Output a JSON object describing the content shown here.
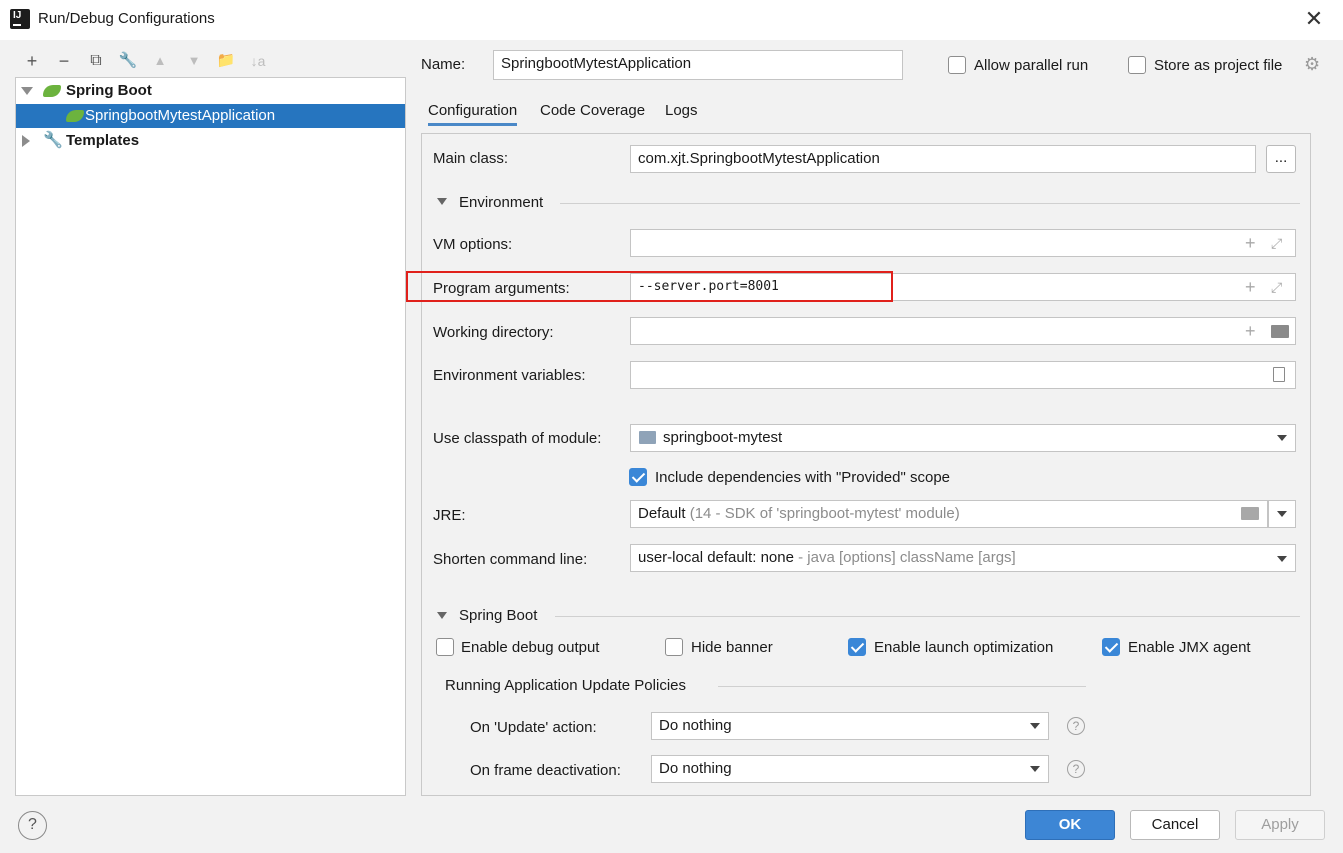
{
  "window": {
    "title": "Run/Debug Configurations"
  },
  "toolbar": {
    "add": "+",
    "remove": "−",
    "copy": "⧉",
    "edit": "🔧",
    "up": "▲",
    "down": "▼",
    "folder": "📁",
    "sort": "↓a"
  },
  "tree": {
    "groups": [
      {
        "label": "Spring Boot",
        "expanded": true,
        "items": [
          {
            "label": "SpringbootMytestApplication",
            "selected": true
          }
        ]
      },
      {
        "label": "Templates",
        "expanded": false,
        "items": []
      }
    ]
  },
  "header": {
    "name_label": "Name:",
    "name_value": "SpringbootMytestApplication",
    "allow_parallel_label": "Allow parallel run",
    "allow_parallel_checked": false,
    "store_project_label": "Store as project file",
    "store_project_checked": false
  },
  "tabs": [
    "Configuration",
    "Code Coverage",
    "Logs"
  ],
  "config": {
    "main_class_label": "Main class:",
    "main_class_value": "com.xjt.SpringbootMytestApplication",
    "browse_label": "...",
    "environment_section": "Environment",
    "vm_options_label": "VM options:",
    "vm_options_value": "",
    "program_args_label": "Program arguments:",
    "program_args_value": "--server.port=8001",
    "working_dir_label": "Working directory:",
    "working_dir_value": "",
    "env_vars_label": "Environment variables:",
    "env_vars_value": "",
    "classpath_label": "Use classpath of module:",
    "classpath_value": "springboot-mytest",
    "include_deps_label": "Include dependencies with \"Provided\" scope",
    "include_deps_checked": true,
    "jre_label": "JRE:",
    "jre_value": "Default",
    "jre_hint": "(14 - SDK of 'springboot-mytest' module)",
    "shorten_label": "Shorten command line:",
    "shorten_value": "user-local default: none",
    "shorten_hint": "- java [options] className [args]",
    "spring_section": "Spring Boot",
    "debug_output_label": "Enable debug output",
    "debug_output_checked": false,
    "hide_banner_label": "Hide banner",
    "hide_banner_checked": false,
    "launch_opt_label": "Enable launch optimization",
    "launch_opt_checked": true,
    "jmx_label": "Enable JMX agent",
    "jmx_checked": true,
    "update_policies_section": "Running Application Update Policies",
    "on_update_label": "On 'Update' action:",
    "on_update_value": "Do nothing",
    "on_frame_label": "On frame deactivation:",
    "on_frame_value": "Do nothing"
  },
  "buttons": {
    "ok": "OK",
    "cancel": "Cancel",
    "apply": "Apply",
    "help": "?"
  },
  "colors": {
    "selection": "#2675bf",
    "accent": "#3d86d5",
    "highlight_box": "#e0201b",
    "spring_green": "#6cb33e"
  }
}
